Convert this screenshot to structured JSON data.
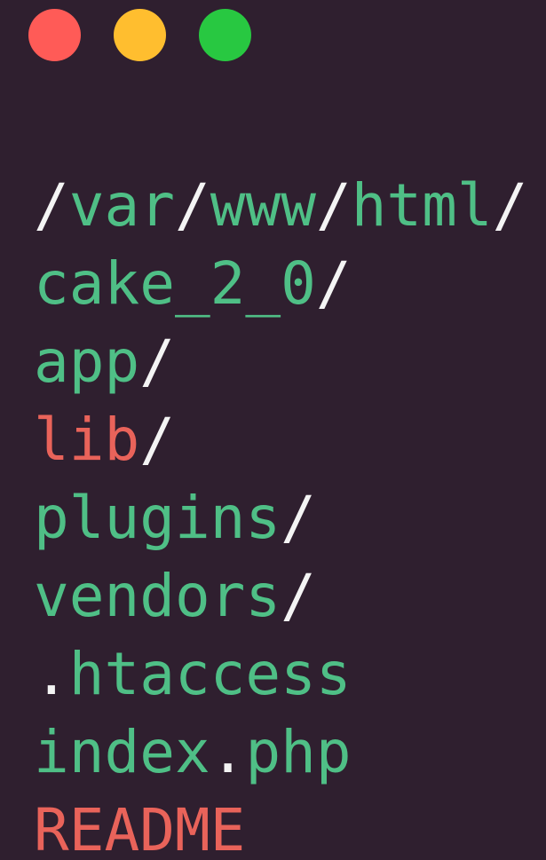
{
  "colors": {
    "background": "#2f1f2f",
    "close": "#ff5b57",
    "minimize": "#ffbe2f",
    "maximize": "#28c841",
    "slash": "#f4f4f4",
    "directory": "#4fbf86",
    "file": "#4fbf86",
    "highlight": "#e9635a"
  },
  "window_controls": [
    {
      "name": "close-button",
      "icon": "circle-red"
    },
    {
      "name": "minimize-button",
      "icon": "circle-yellow"
    },
    {
      "name": "maximize-button",
      "icon": "circle-green"
    }
  ],
  "entries": [
    {
      "name": "path-root",
      "segments": [
        {
          "text": "/",
          "role": "slash"
        },
        {
          "text": "var",
          "role": "directory"
        },
        {
          "text": "/",
          "role": "slash"
        },
        {
          "text": "www",
          "role": "directory"
        },
        {
          "text": "/",
          "role": "slash"
        },
        {
          "text": "html",
          "role": "directory"
        },
        {
          "text": "/",
          "role": "slash"
        }
      ]
    },
    {
      "name": "entry-cake",
      "segments": [
        {
          "text": "cake_2_0",
          "role": "directory"
        },
        {
          "text": "/",
          "role": "slash"
        }
      ]
    },
    {
      "name": "entry-app",
      "segments": [
        {
          "text": "app",
          "role": "directory"
        },
        {
          "text": "/",
          "role": "slash"
        }
      ]
    },
    {
      "name": "entry-lib",
      "segments": [
        {
          "text": "lib",
          "role": "highlight"
        },
        {
          "text": "/",
          "role": "slash"
        }
      ]
    },
    {
      "name": "entry-plugins",
      "segments": [
        {
          "text": "plugins",
          "role": "directory"
        },
        {
          "text": "/",
          "role": "slash"
        }
      ]
    },
    {
      "name": "entry-vendors",
      "segments": [
        {
          "text": "vendors",
          "role": "directory"
        },
        {
          "text": "/",
          "role": "slash"
        }
      ]
    },
    {
      "name": "entry-htaccess",
      "segments": [
        {
          "text": ".",
          "role": "slash"
        },
        {
          "text": "htaccess",
          "role": "file"
        }
      ]
    },
    {
      "name": "entry-index-php",
      "segments": [
        {
          "text": "index",
          "role": "file"
        },
        {
          "text": ".",
          "role": "slash"
        },
        {
          "text": "php",
          "role": "file"
        }
      ]
    },
    {
      "name": "entry-readme",
      "segments": [
        {
          "text": "README",
          "role": "highlight"
        }
      ]
    }
  ]
}
